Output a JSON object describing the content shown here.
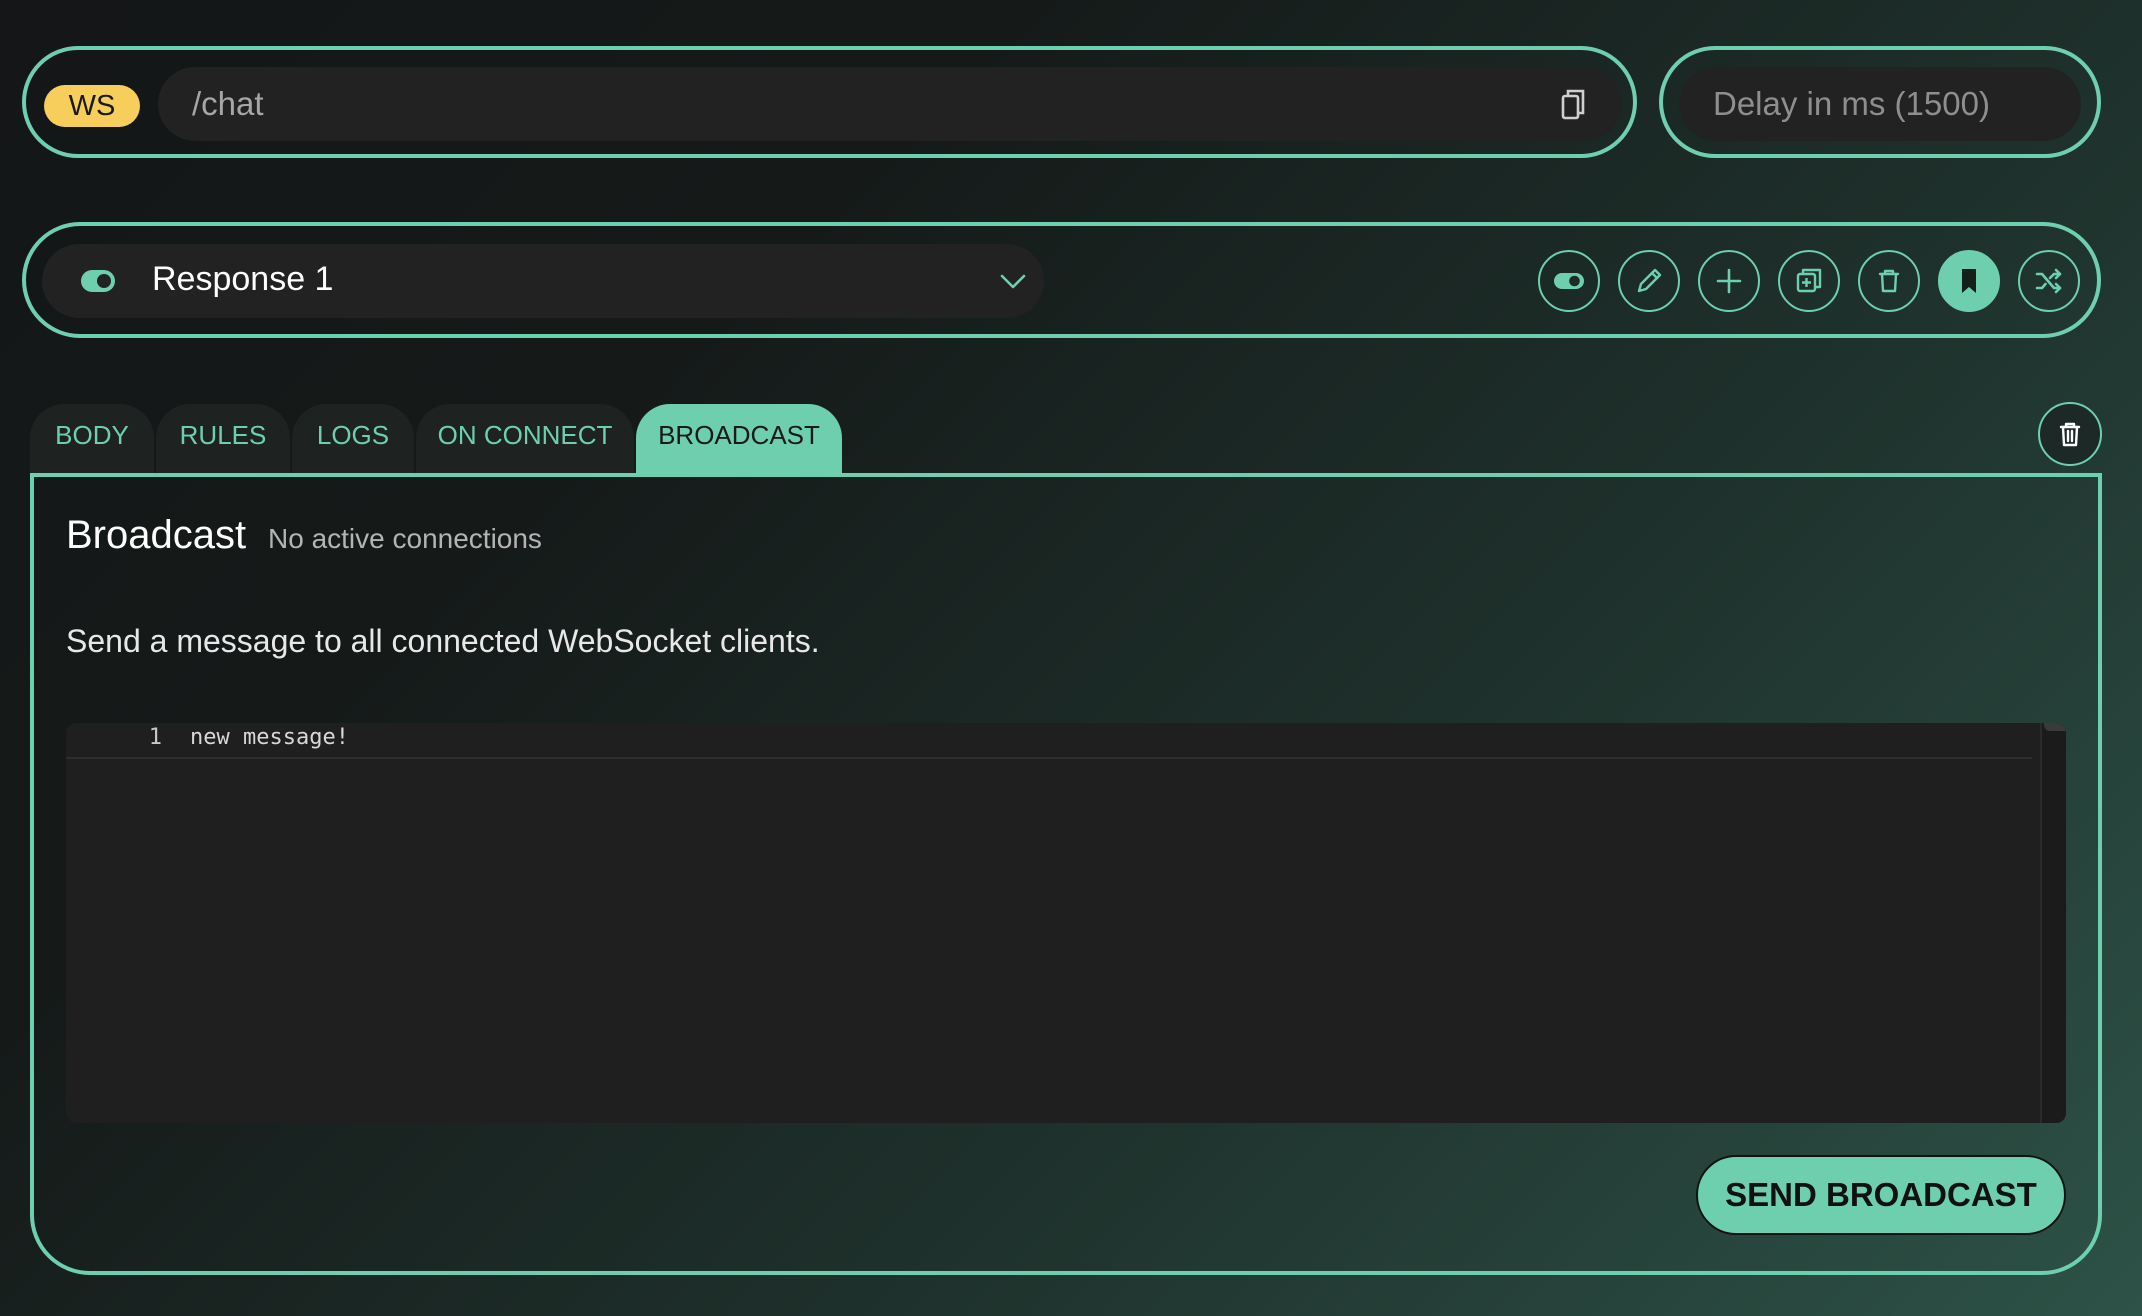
{
  "route_bar": {
    "method": "WS",
    "path": "/chat"
  },
  "delay": {
    "placeholder": "Delay in ms (1500)"
  },
  "response": {
    "selected": "Response 1"
  },
  "tabs": [
    {
      "label": "BODY",
      "active": false
    },
    {
      "label": "RULES",
      "active": false
    },
    {
      "label": "LOGS",
      "active": false
    },
    {
      "label": "ON CONNECT",
      "active": false
    },
    {
      "label": "BROADCAST",
      "active": true
    }
  ],
  "broadcast": {
    "title": "Broadcast",
    "status": "No active connections",
    "description": "Send a message to all connected WebSocket clients.",
    "editor_lines": [
      {
        "number": "1",
        "text": "new message!"
      }
    ],
    "send_label": "SEND BROADCAST"
  },
  "colors": {
    "accent": "#6ecfaf",
    "method_badge": "#f7ce5c",
    "input_bg": "#222222"
  },
  "icons": {
    "route": "copy-icon",
    "response_toggle": "toggle-icon",
    "dropdown": "chevron-down-icon",
    "toolbar": [
      "toggle-icon",
      "pencil-icon",
      "plus-icon",
      "duplicate-icon",
      "trash-icon",
      "bookmark-icon",
      "shuffle-icon"
    ],
    "clear_logs": "trash-icon"
  }
}
